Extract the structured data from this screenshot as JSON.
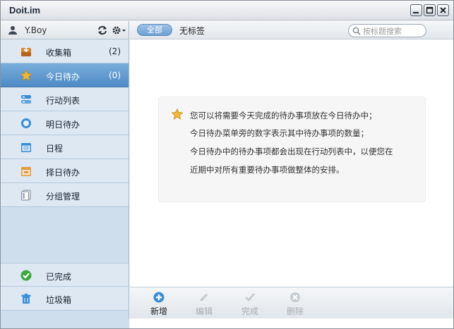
{
  "window": {
    "title": "Doit.im"
  },
  "sidebar": {
    "username": "Y.Boy",
    "items": [
      {
        "label": "收集箱",
        "count": "(2)",
        "icon": "inbox-icon",
        "active": false
      },
      {
        "label": "今日待办",
        "count": "(0)",
        "icon": "star-icon",
        "active": true
      },
      {
        "label": "行动列表",
        "count": "",
        "icon": "list-icon",
        "active": false
      },
      {
        "label": "明日待办",
        "count": "",
        "icon": "clock-icon",
        "active": false
      },
      {
        "label": "日程",
        "count": "",
        "icon": "calendar-icon",
        "active": false
      },
      {
        "label": "择日待办",
        "count": "",
        "icon": "calendar-date-icon",
        "active": false
      },
      {
        "label": "分组管理",
        "count": "",
        "icon": "folders-icon",
        "active": false
      }
    ],
    "bottom_items": [
      {
        "label": "已完成",
        "icon": "check-circle-icon"
      },
      {
        "label": "垃圾箱",
        "icon": "trash-icon"
      }
    ]
  },
  "toolbar": {
    "all_label": "全部",
    "untagged_label": "无标签",
    "search_placeholder": "按标题搜索"
  },
  "hint": {
    "lines": [
      "您可以将需要今天完成的待办事项放在今日待办中；",
      "今日待办菜单旁的数字表示其中待办事项的数量；",
      " 今日待办中的待办事项都会出现在行动列表中，以便您在",
      "近期中对所有重要待办事项做整体的安排。"
    ]
  },
  "actions": [
    {
      "label": "新增",
      "enabled": true
    },
    {
      "label": "编辑",
      "enabled": false
    },
    {
      "label": "完成",
      "enabled": false
    },
    {
      "label": "删除",
      "enabled": false
    }
  ],
  "colors": {
    "accent": "#5b93cd",
    "sidebar_bg": "#cfdeec",
    "star": "#f0a830"
  }
}
